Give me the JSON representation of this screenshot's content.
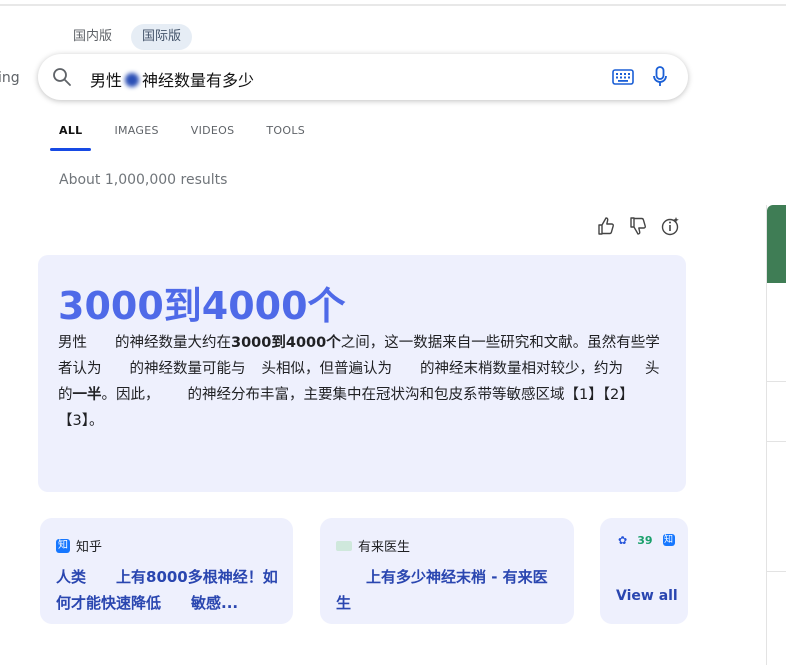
{
  "edge_text": "ing",
  "version_tabs": [
    {
      "label": "国内版",
      "active": false
    },
    {
      "label": "国际版",
      "active": true
    }
  ],
  "search": {
    "query_part1": "男性",
    "query_part2": "神经数量有多少"
  },
  "nav_tabs": [
    {
      "label": "ALL",
      "active": true
    },
    {
      "label": "IMAGES",
      "active": false
    },
    {
      "label": "VIDEOS",
      "active": false
    },
    {
      "label": "TOOLS",
      "active": false
    }
  ],
  "results_count": "About 1,000,000 results",
  "answer": {
    "title": "3000到4000个",
    "p1": "男性",
    "p2": "的神经数量大约在",
    "p3": "3000到4000个",
    "p4": "之间，这一数据来自一些研究和文献。虽然有些学者认为",
    "p5": "的神经数量可能与",
    "p6": "头相似，但普遍认为",
    "p7": "的神经末梢数量相对较少，约为",
    "p8": "头的",
    "p9": "一半",
    "p10": "。因此，",
    "p11": "的神经分布丰富，主要集中在冠状沟和包皮系带等敏感区域【1】【2】【3】。"
  },
  "sources": [
    {
      "site": "知乎",
      "badge": "知",
      "title": "人类　　上有8000多根神经！如何才能快速降低　　敏感..."
    },
    {
      "site": "有来医生",
      "title": "　　上有多少神经末梢 - 有来医生"
    },
    {
      "view_all": "View all",
      "icons": [
        "✿",
        "39",
        "知"
      ]
    }
  ],
  "colors": {
    "accent": "#4f6ae8",
    "link": "#2a46b0",
    "card_bg": "#eef0fd",
    "tab_underline": "#174ae4"
  }
}
